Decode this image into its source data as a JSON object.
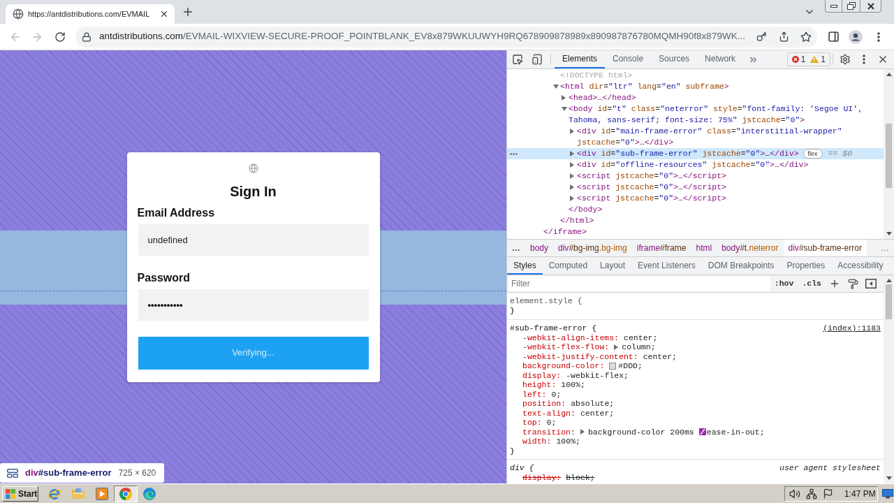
{
  "browser": {
    "tab": {
      "title": "https://antdistributions.com/EVMAIL",
      "selected": true
    },
    "address": {
      "host": "antdistributions.com",
      "path": "/EVMAIL-WIXVIEW-SECURE-PROOF_POINTBLANK_EV8x879WKUUWYH9RQ678909878989x890987876780MQMH90f8x879WK..."
    }
  },
  "page": {
    "card": {
      "title": "Sign In",
      "fields": [
        {
          "kind": "text",
          "label": "Email Address",
          "value": "undefined"
        },
        {
          "kind": "password",
          "label": "Password",
          "value": "•••••••••••"
        }
      ],
      "button": "Verifying..."
    },
    "inspect_tooltip": {
      "selector": "div#sub-frame-error",
      "size": "725 × 620"
    }
  },
  "devtools": {
    "tabs": [
      {
        "label": "Elements",
        "selected": true
      },
      {
        "label": "Console",
        "selected": false
      },
      {
        "label": "Sources",
        "selected": false
      },
      {
        "label": "Network",
        "selected": false
      }
    ],
    "issues": {
      "errors": "1",
      "warnings": "1"
    },
    "dom_tree": {
      "nodes": [
        {
          "kind": "doctype",
          "text": "<!DOCTYPE html>",
          "selected": false
        },
        {
          "kind": "element",
          "text": "<html dir=\"ltr\" lang=\"en\" subframe>",
          "expanded": true,
          "selected": false,
          "children": [
            {
              "kind": "element",
              "text": "<head>…</head>",
              "expanded": false,
              "selected": false
            },
            {
              "kind": "element",
              "text": "<body id=\"t\" class=\"neterror\" style=\"font-family: 'Segoe UI', Tahoma, sans-serif; font-size: 75%\" jstcache=\"0\">",
              "expanded": true,
              "selected": false,
              "children": [
                {
                  "kind": "element",
                  "text": "<div id=\"main-frame-error\" class=\"interstitial-wrapper\"",
                  "continuation": "jstcache=\"0\">…</div>",
                  "expanded": false,
                  "selected": false
                },
                {
                  "kind": "element",
                  "text": "<div id=\"sub-frame-error\" jstcache=\"0\">…</div>",
                  "expanded": false,
                  "selected": true,
                  "badge": "flex",
                  "suffix": "== $0"
                },
                {
                  "kind": "element",
                  "text": "<div id=\"offline-resources\" jstcache=\"0\">…</div>",
                  "expanded": false,
                  "selected": false
                },
                {
                  "kind": "element",
                  "text": "<script jstcache=\"0\">…</script>",
                  "expanded": false,
                  "selected": false
                },
                {
                  "kind": "element",
                  "text": "<script jstcache=\"0\">…</script>",
                  "expanded": false,
                  "selected": false
                },
                {
                  "kind": "element",
                  "text": "<script jstcache=\"0\">…</script>",
                  "expanded": false,
                  "selected": false
                }
              ],
              "closing": "</body>"
            }
          ],
          "closing": "</html>"
        }
      ],
      "closing": "</iframe>"
    },
    "breadcrumbs": {
      "more_left": "…",
      "items": [
        {
          "label": "body",
          "selected": false
        },
        {
          "label": "div#bg-img.bg-img",
          "selected": false
        },
        {
          "label": "iframe#frame",
          "selected": false
        },
        {
          "label": "html",
          "selected": false
        },
        {
          "label": "body#t.neterror",
          "selected": false
        },
        {
          "label": "div#sub-frame-error",
          "selected": true
        }
      ],
      "more_right": "…"
    },
    "sidebar_tabs": [
      {
        "label": "Styles",
        "selected": true
      },
      {
        "label": "Computed",
        "selected": false
      },
      {
        "label": "Layout",
        "selected": false
      },
      {
        "label": "Event Listeners",
        "selected": false
      },
      {
        "label": "DOM Breakpoints",
        "selected": false
      },
      {
        "label": "Properties",
        "selected": false
      },
      {
        "label": "Accessibility",
        "selected": false
      }
    ],
    "filter": {
      "placeholder": "Filter",
      "toggles": [
        ":hov",
        ".cls"
      ]
    },
    "rules": [
      {
        "kind": "inline",
        "selector": "element.style {",
        "closing": "}"
      },
      {
        "kind": "author",
        "selector": "#sub-frame-error {",
        "source": "(index):1183",
        "declarations": [
          {
            "kind": "plain",
            "property": "-webkit-align-items:",
            "value": "center;",
            "overridden": false
          },
          {
            "kind": "expandable",
            "property": "-webkit-flex-flow:",
            "value": "column;",
            "overridden": false
          },
          {
            "kind": "plain",
            "property": "-webkit-justify-content:",
            "value": "center;",
            "overridden": false
          },
          {
            "kind": "color",
            "property": "background-color:",
            "value": "#DDD;",
            "color": "#dddddd",
            "overridden": false
          },
          {
            "kind": "plain",
            "property": "display:",
            "value": "-webkit-flex;",
            "overridden": false
          },
          {
            "kind": "plain",
            "property": "height:",
            "value": "100%;",
            "overridden": false
          },
          {
            "kind": "plain",
            "property": "left:",
            "value": "0;",
            "overridden": false
          },
          {
            "kind": "plain",
            "property": "position:",
            "value": "absolute;",
            "overridden": false
          },
          {
            "kind": "plain",
            "property": "text-align:",
            "value": "center;",
            "overridden": false
          },
          {
            "kind": "plain",
            "property": "top:",
            "value": "0;",
            "overridden": false
          },
          {
            "kind": "transition",
            "property": "transition:",
            "value": "background-color 200ms",
            "easing": "ease-in-out;",
            "overridden": false
          },
          {
            "kind": "plain",
            "property": "width:",
            "value": "100%;",
            "overridden": false
          }
        ],
        "closing": "}"
      },
      {
        "kind": "user_agent",
        "selector": "div {",
        "source": "user agent stylesheet",
        "declarations": [
          {
            "kind": "plain",
            "property": "display:",
            "value": "block;",
            "overridden": true
          }
        ]
      }
    ]
  },
  "taskbar": {
    "start": "Start",
    "apps": [
      {
        "kind": "ie",
        "selected": false
      },
      {
        "kind": "folder",
        "selected": false
      },
      {
        "kind": "media",
        "selected": false
      },
      {
        "kind": "chrome",
        "selected": true
      },
      {
        "kind": "edge",
        "selected": false
      }
    ],
    "clock": "1:47 PM"
  }
}
